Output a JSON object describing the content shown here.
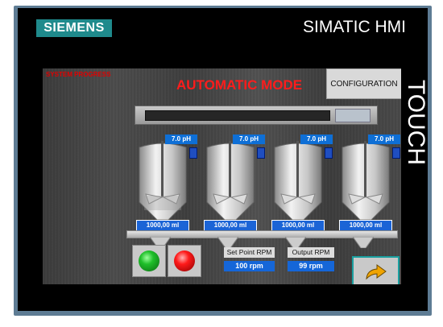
{
  "brand": "SIEMENS",
  "product": "SIMATIC HMI",
  "touch_label": "TOUCH",
  "screen": {
    "system_progress": "SYSTEM PROGRESS",
    "mode_title": "AUTOMATIC MODE",
    "configuration_button": "CONFIGURATION"
  },
  "tanks": [
    {
      "ph": "7.0  pH",
      "volume": "1000,00 ml"
    },
    {
      "ph": "7.0  pH",
      "volume": "1000,00 ml"
    },
    {
      "ph": "7.0  pH",
      "volume": "1000,00 ml"
    },
    {
      "ph": "7.0  pH",
      "volume": "1000,00 ml"
    }
  ],
  "controls": {
    "start_icon": "green-start-lamp",
    "stop_icon": "red-stop-lamp",
    "setpoint_label": "Set Point RPM",
    "setpoint_value": "100 rpm",
    "output_label": "Output RPM",
    "output_value": "99 rpm",
    "next_icon": "arrow-next-icon"
  },
  "colors": {
    "bezel": "#5e7c94",
    "brand_bg": "#1f8a8c",
    "mode_red": "#ff1c1c",
    "value_blue": "#1566d8"
  }
}
